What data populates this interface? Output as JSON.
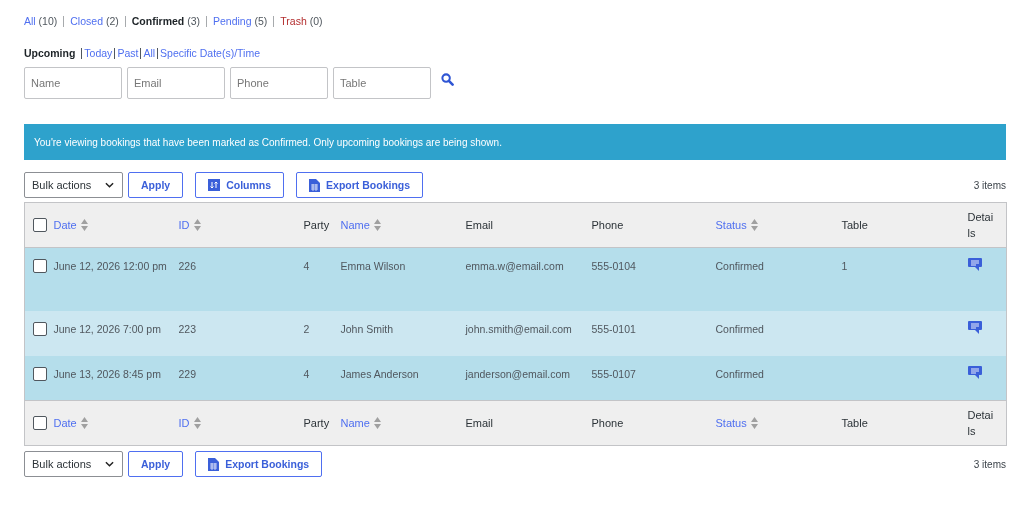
{
  "status_links": [
    {
      "label": "All",
      "count": "(10)",
      "selected": false,
      "kind": "normal"
    },
    {
      "label": "Closed",
      "count": "(2)",
      "selected": false,
      "kind": "normal"
    },
    {
      "label": "Confirmed",
      "count": "(3)",
      "selected": true,
      "kind": "normal"
    },
    {
      "label": "Pending",
      "count": "(5)",
      "selected": false,
      "kind": "normal"
    },
    {
      "label": "Trash",
      "count": "(0)",
      "selected": false,
      "kind": "trash"
    }
  ],
  "views": [
    {
      "label": "Upcoming",
      "selected": true
    },
    {
      "label": "Today",
      "selected": false
    },
    {
      "label": "Past",
      "selected": false
    },
    {
      "label": "All",
      "selected": false
    },
    {
      "label": "Specific Date(s)/Time",
      "selected": false
    }
  ],
  "filters": [
    {
      "placeholder": "Name"
    },
    {
      "placeholder": "Email"
    },
    {
      "placeholder": "Phone"
    },
    {
      "placeholder": "Table"
    }
  ],
  "notice": "You're viewing bookings that have been marked as Confirmed. Only upcoming bookings are being shown.",
  "top_toolbar": {
    "bulk_actions": "Bulk actions",
    "apply": "Apply",
    "columns": "Columns",
    "export": "Export Bookings",
    "count": "3 items"
  },
  "table": {
    "header": {
      "checked": false,
      "columns": [
        {
          "label": "Date",
          "sortable": true
        },
        {
          "label": "ID",
          "sortable": true
        },
        {
          "label": "Party",
          "sortable": false
        },
        {
          "label": "Name",
          "sortable": true
        },
        {
          "label": "Email",
          "sortable": false
        },
        {
          "label": "Phone",
          "sortable": false
        },
        {
          "label": "Status",
          "sortable": true
        },
        {
          "label": "Table",
          "sortable": false
        },
        {
          "label": "Details",
          "sortable": false
        }
      ]
    },
    "rows": [
      {
        "checked": false,
        "cells": [
          "June 12, 2026 12:00 pm",
          "226",
          "4",
          "Emma Wilson",
          "emma.w@email.com",
          "555-0104",
          "Confirmed",
          "1"
        ]
      },
      {
        "checked": false,
        "cells": [
          "June 12, 2026 7:00 pm",
          "223",
          "2",
          "John Smith",
          "john.smith@email.com",
          "555-0101",
          "Confirmed",
          ""
        ]
      },
      {
        "checked": false,
        "cells": [
          "June 13, 2026 8:45 pm",
          "229",
          "4",
          "James Anderson",
          "janderson@email.com",
          "555-0107",
          "Confirmed",
          ""
        ]
      }
    ],
    "footer": {
      "checked": false,
      "columns": [
        {
          "label": "Date",
          "sortable": true
        },
        {
          "label": "ID",
          "sortable": true
        },
        {
          "label": "Party",
          "sortable": false
        },
        {
          "label": "Name",
          "sortable": true
        },
        {
          "label": "Email",
          "sortable": false
        },
        {
          "label": "Phone",
          "sortable": false
        },
        {
          "label": "Status",
          "sortable": true
        },
        {
          "label": "Table",
          "sortable": false
        },
        {
          "label": "Details",
          "sortable": false
        }
      ]
    }
  },
  "bottom_toolbar": {
    "bulk_actions": "Bulk actions",
    "apply": "Apply",
    "export": "Export Bookings",
    "count": "3 items"
  }
}
